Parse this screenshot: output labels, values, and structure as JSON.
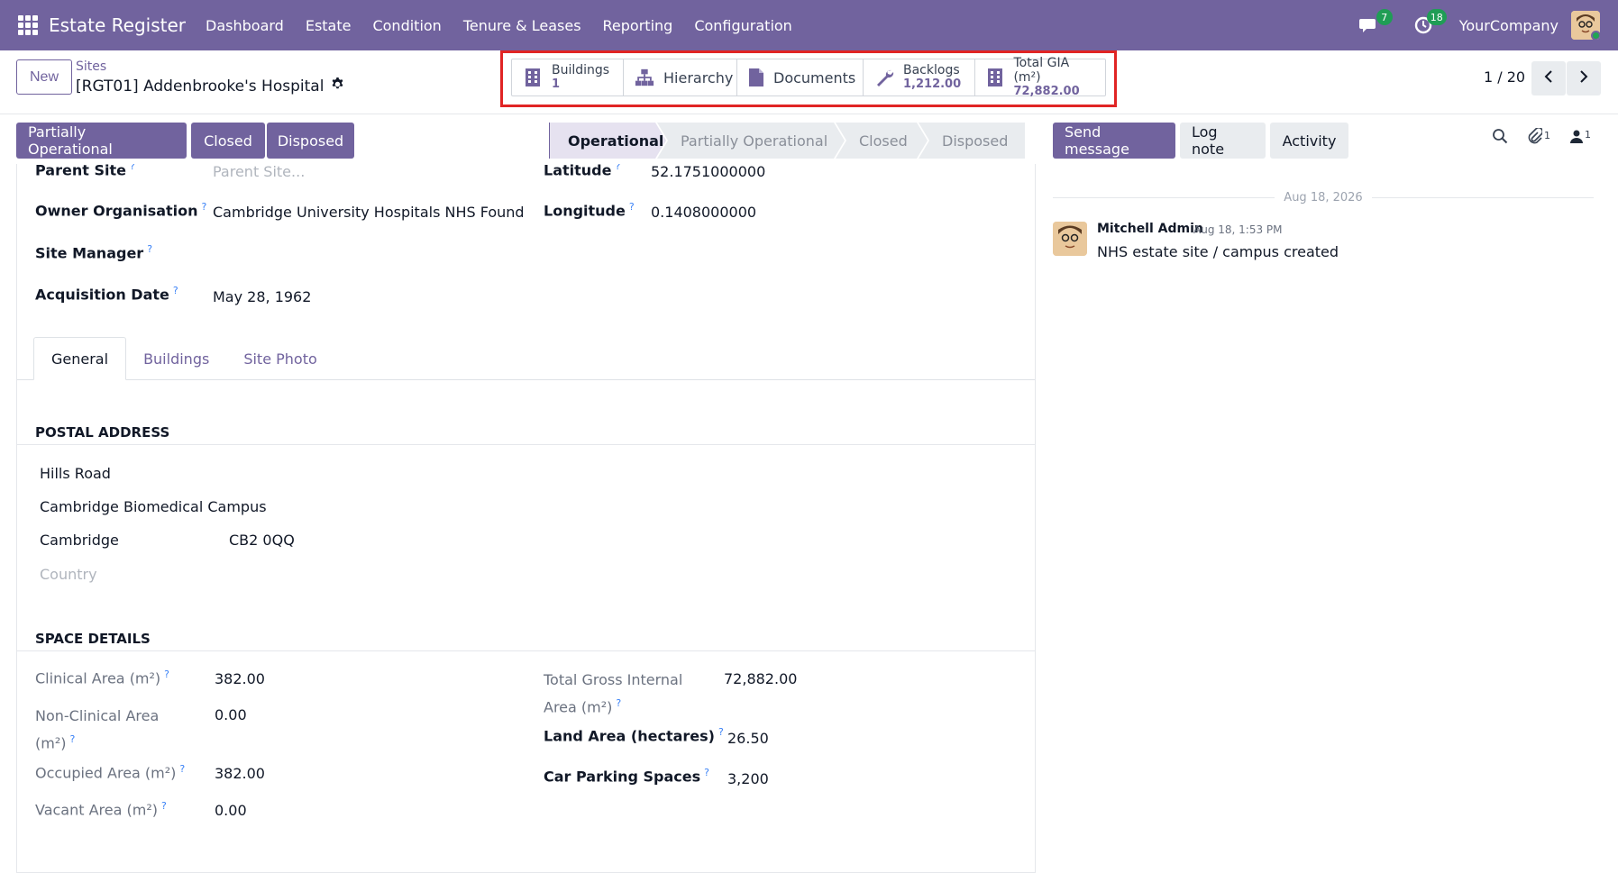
{
  "nav": {
    "brand": "Estate Register",
    "menu": [
      "Dashboard",
      "Estate",
      "Condition",
      "Tenure & Leases",
      "Reporting",
      "Configuration"
    ],
    "messages_count": "7",
    "activities_count": "18",
    "company": "YourCompany"
  },
  "control": {
    "new_label": "New",
    "breadcrumb_parent": "Sites",
    "breadcrumb_current": "[RGT01] Addenbrooke's Hospital",
    "pager": "1 / 20"
  },
  "smart_buttons": {
    "buildings": {
      "label": "Buildings",
      "value": "1"
    },
    "hierarchy": {
      "label": "Hierarchy"
    },
    "documents": {
      "label": "Documents"
    },
    "backlogs": {
      "label": "Backlogs",
      "value": "1,212.00"
    },
    "total_gia": {
      "label": "Total GIA (m²)",
      "value": "72,882.00"
    }
  },
  "status_actions": [
    "Partially Operational",
    "Closed",
    "Disposed"
  ],
  "stages": [
    "Operational",
    "Partially Operational",
    "Closed",
    "Disposed"
  ],
  "chatter_actions": {
    "send": "Send message",
    "log": "Log note",
    "activity": "Activity",
    "attachments": "1",
    "followers": "1"
  },
  "form": {
    "parent_site_label": "Parent Site",
    "parent_site_placeholder": "Parent Site...",
    "owner_label": "Owner Organisation",
    "owner_value": "Cambridge University Hospitals NHS Found",
    "manager_label": "Site Manager",
    "acq_label": "Acquisition Date",
    "acq_value": "May 28, 1962",
    "lat_label": "Latitude",
    "lat_value": "52.1751000000",
    "lon_label": "Longitude",
    "lon_value": "0.1408000000"
  },
  "tabs": [
    "General",
    "Buildings",
    "Site Photo"
  ],
  "postal": {
    "title": "POSTAL ADDRESS",
    "street": "Hills Road",
    "street2": "Cambridge Biomedical Campus",
    "city": "Cambridge",
    "zip": "CB2 0QQ",
    "country_placeholder": "Country"
  },
  "space": {
    "title": "SPACE DETAILS",
    "clinical_label": "Clinical Area (m²)",
    "clinical_value": "382.00",
    "nonclinical_label_1": "Non-Clinical Area",
    "nonclinical_label_2": "(m²)",
    "nonclinical_value": "0.00",
    "occupied_label": "Occupied Area (m²)",
    "occupied_value": "382.00",
    "vacant_label": "Vacant Area (m²)",
    "vacant_value": "0.00",
    "tgia_label_1": "Total Gross Internal",
    "tgia_label_2": "Area (m²)",
    "tgia_value": "72,882.00",
    "land_label": "Land Area (hectares)",
    "land_value": "26.50",
    "parking_label": "Car Parking Spaces",
    "parking_value": "3,200"
  },
  "chatter": {
    "date": "Aug 18, 2026",
    "author": "Mitchell Admin",
    "time": "Aug 18, 1:53 PM",
    "body": "NHS estate site / campus created"
  },
  "colors": {
    "brand": "#71639e",
    "highlight": "#e02424",
    "badge": "#1f9d55"
  }
}
